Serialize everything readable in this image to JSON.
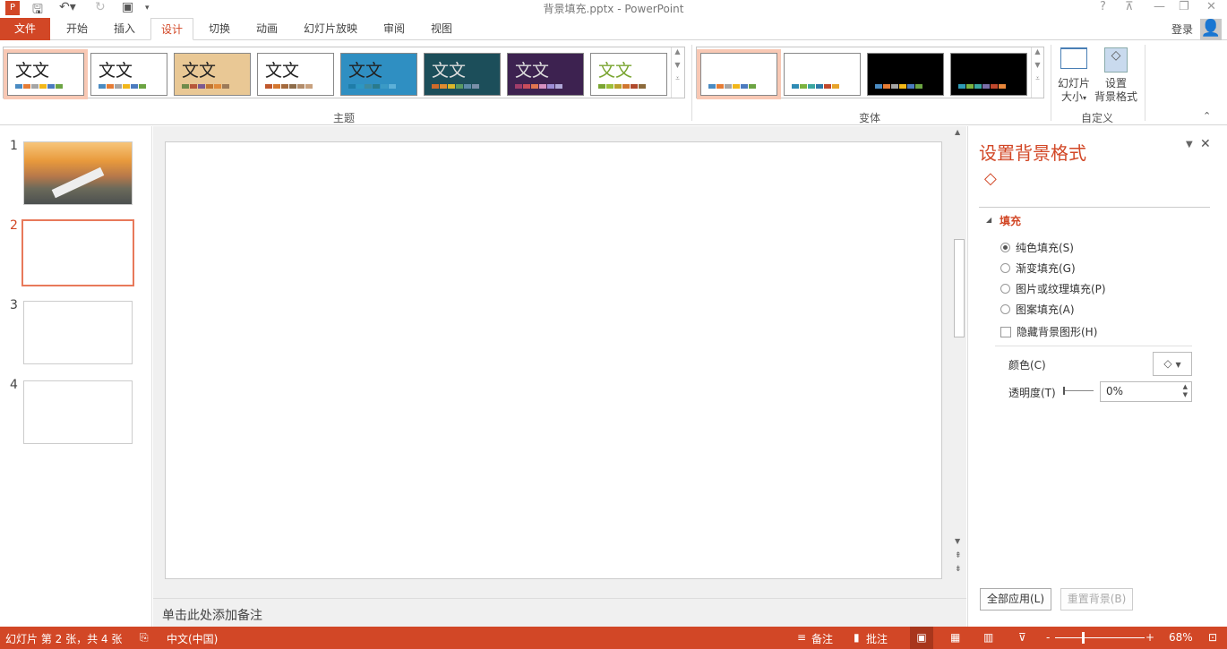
{
  "window": {
    "title": "背景填充.pptx - PowerPoint",
    "help": "?",
    "ribbon_display": "⊼",
    "minimize": "—",
    "restore": "❐",
    "close": "✕"
  },
  "account": {
    "signin": "登录"
  },
  "tabs": [
    {
      "label": "文件"
    },
    {
      "label": "开始"
    },
    {
      "label": "插入"
    },
    {
      "label": "设计"
    },
    {
      "label": "切换"
    },
    {
      "label": "动画"
    },
    {
      "label": "幻灯片放映"
    },
    {
      "label": "审阅"
    },
    {
      "label": "视图"
    }
  ],
  "ribbon": {
    "themes_label": "主题",
    "theme_sample": "文文",
    "themes": [
      {
        "bg": "#ffffff",
        "fg": "#222",
        "colors": [
          "#4a8bc2",
          "#e67c35",
          "#a5a5a5",
          "#f2b719",
          "#4c7bbf",
          "#6ca443"
        ]
      },
      {
        "bg": "#ffffff",
        "fg": "#222",
        "colors": [
          "#4a8bc2",
          "#e67c35",
          "#a5a5a5",
          "#f2b719",
          "#4c7bbf",
          "#6ca443"
        ]
      },
      {
        "bg": "#e9c895",
        "fg": "#222",
        "colors": [
          "#6f8b4a",
          "#b7573a",
          "#7b5a90",
          "#c1752f",
          "#e08a3a",
          "#9c7a58"
        ]
      },
      {
        "bg": "#ffffff",
        "fg": "#222",
        "colors": [
          "#c0582d",
          "#d4772f",
          "#a46a3d",
          "#8d6c4a",
          "#b38d6b",
          "#c8a17e"
        ]
      },
      {
        "bg": "#2f8fc2",
        "fg": "#222",
        "colors": [
          "#1f7da8",
          "#2d97c2",
          "#3d8a9e",
          "#297a8c",
          "#3b9ac5",
          "#5db0d8"
        ]
      },
      {
        "bg": "#1c4e5a",
        "fg": "#ddd",
        "colors": [
          "#d06a2a",
          "#e08a30",
          "#d9b62a",
          "#5a9a63",
          "#5e8ba8",
          "#7a8fa8"
        ]
      },
      {
        "bg": "#3d2250",
        "fg": "#ddd",
        "colors": [
          "#a03d6a",
          "#c84d5b",
          "#e07650",
          "#d690c0",
          "#9d8ed6",
          "#b0a8d8"
        ]
      },
      {
        "bg": "#ffffff",
        "fg": "#7aa532",
        "colors": [
          "#7aa532",
          "#9cbf3a",
          "#b9a12d",
          "#d0762f",
          "#b04a2c",
          "#8c6a3b"
        ]
      }
    ],
    "variants_label": "变体",
    "variants": [
      {
        "bg": "#ffffff",
        "colors": [
          "#4a8bc2",
          "#e67c35",
          "#a5a5a5",
          "#f2b719",
          "#4c7bbf",
          "#6ca443"
        ]
      },
      {
        "bg": "#ffffff",
        "colors": [
          "#2e8bb5",
          "#7bb33f",
          "#3aa6a0",
          "#2d7aa8",
          "#c0482d",
          "#e8a42a"
        ]
      },
      {
        "bg": "#000000",
        "colors": [
          "#4a8bc2",
          "#e67c35",
          "#a5a5a5",
          "#f2b719",
          "#4c7bbf",
          "#6ca443"
        ]
      },
      {
        "bg": "#000000",
        "colors": [
          "#2e9ab5",
          "#7bb33f",
          "#3aa6a0",
          "#7a6fa8",
          "#c0482d",
          "#e8863a"
        ]
      }
    ],
    "customize_label": "自定义",
    "slide_size_line1": "幻灯片",
    "slide_size_line2": "大小",
    "format_bg_line1": "设置",
    "format_bg_line2": "背景格式"
  },
  "slides": [
    {
      "num": "1"
    },
    {
      "num": "2"
    },
    {
      "num": "3"
    },
    {
      "num": "4"
    }
  ],
  "notes_placeholder": "单击此处添加备注",
  "pane": {
    "title": "设置背景格式",
    "section": "填充",
    "options": [
      {
        "label": "纯色填充(S)",
        "checked": true
      },
      {
        "label": "渐变填充(G)"
      },
      {
        "label": "图片或纹理填充(P)"
      },
      {
        "label": "图案填充(A)"
      }
    ],
    "hide_bg_graphics": "隐藏背景图形(H)",
    "color_label": "颜色(C)",
    "transparency_label": "透明度(T)",
    "transparency_value": "0%",
    "apply_all": "全部应用(L)",
    "reset_bg": "重置背景(B)"
  },
  "status": {
    "slide_info": "幻灯片 第 2 张，共 4 张",
    "language": "中文(中国)",
    "notes": "备注",
    "comments": "批注",
    "zoom": "68%",
    "accent": "#d24726"
  }
}
